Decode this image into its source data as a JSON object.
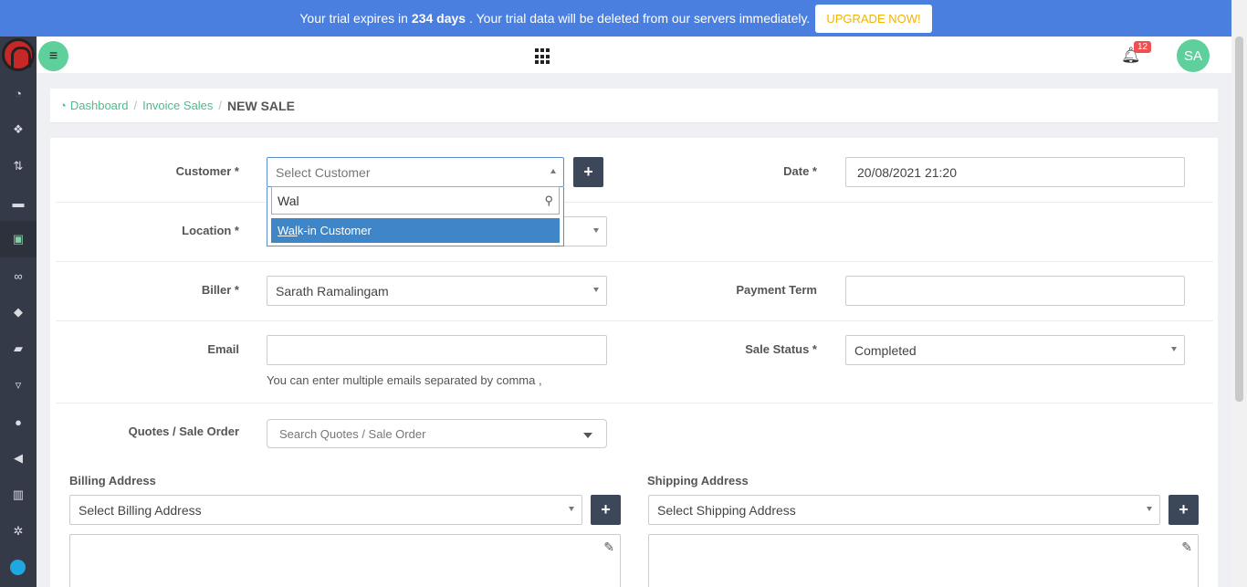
{
  "banner": {
    "prefix": "Your trial expires in",
    "days": "234 days",
    "suffix": ". Your trial data will be deleted from our servers immediately.",
    "upgrade_label": "UPGRADE NOW!"
  },
  "header": {
    "notification_count": "12",
    "avatar_initials": "SA"
  },
  "sidebar": {
    "items": [
      {
        "icon": "dashboard-icon",
        "glyph": "◔"
      },
      {
        "icon": "cubes-icon",
        "glyph": "❖"
      },
      {
        "icon": "exchange-icon",
        "glyph": "⇅"
      },
      {
        "icon": "bed-icon",
        "glyph": "▬"
      },
      {
        "icon": "basket-icon",
        "glyph": "▣"
      },
      {
        "icon": "handshake-icon",
        "glyph": "∞"
      },
      {
        "icon": "tags-icon",
        "glyph": "◆"
      },
      {
        "icon": "truck-icon",
        "glyph": "▰"
      },
      {
        "icon": "cart-icon",
        "glyph": "▿"
      },
      {
        "icon": "users-icon",
        "glyph": "●"
      },
      {
        "icon": "bullhorn-icon",
        "glyph": "◀"
      },
      {
        "icon": "bar-chart-icon",
        "glyph": "▥"
      },
      {
        "icon": "gear-icon",
        "glyph": "✲"
      }
    ]
  },
  "breadcrumb": {
    "dashboard": "Dashboard",
    "invoice_sales": "Invoice Sales",
    "current": "NEW SALE"
  },
  "form": {
    "customer_label": "Customer *",
    "customer_placeholder": "Select Customer",
    "customer_search_value": "Wal",
    "customer_option_match": "Wal",
    "customer_option_rest": "k-in Customer",
    "date_label": "Date *",
    "date_value": "20/08/2021 21:20",
    "location_label": "Location *",
    "biller_label": "Biller *",
    "biller_value": "Sarath Ramalingam",
    "payment_term_label": "Payment Term",
    "payment_term_value": "",
    "email_label": "Email",
    "email_value": "",
    "email_help": "You can enter multiple emails separated by comma ,",
    "sale_status_label": "Sale Status *",
    "sale_status_value": "Completed",
    "quotes_label": "Quotes / Sale Order",
    "quotes_placeholder": "Search Quotes / Sale Order",
    "billing_label": "Billing Address",
    "billing_placeholder": "Select Billing Address",
    "shipping_label": "Shipping Address",
    "shipping_placeholder": "Select Shipping Address"
  },
  "colors": {
    "banner": "#4a7fe0",
    "accent": "#5fcf9b",
    "sidebar": "#343a47",
    "option_highlight": "#3f86c9"
  }
}
